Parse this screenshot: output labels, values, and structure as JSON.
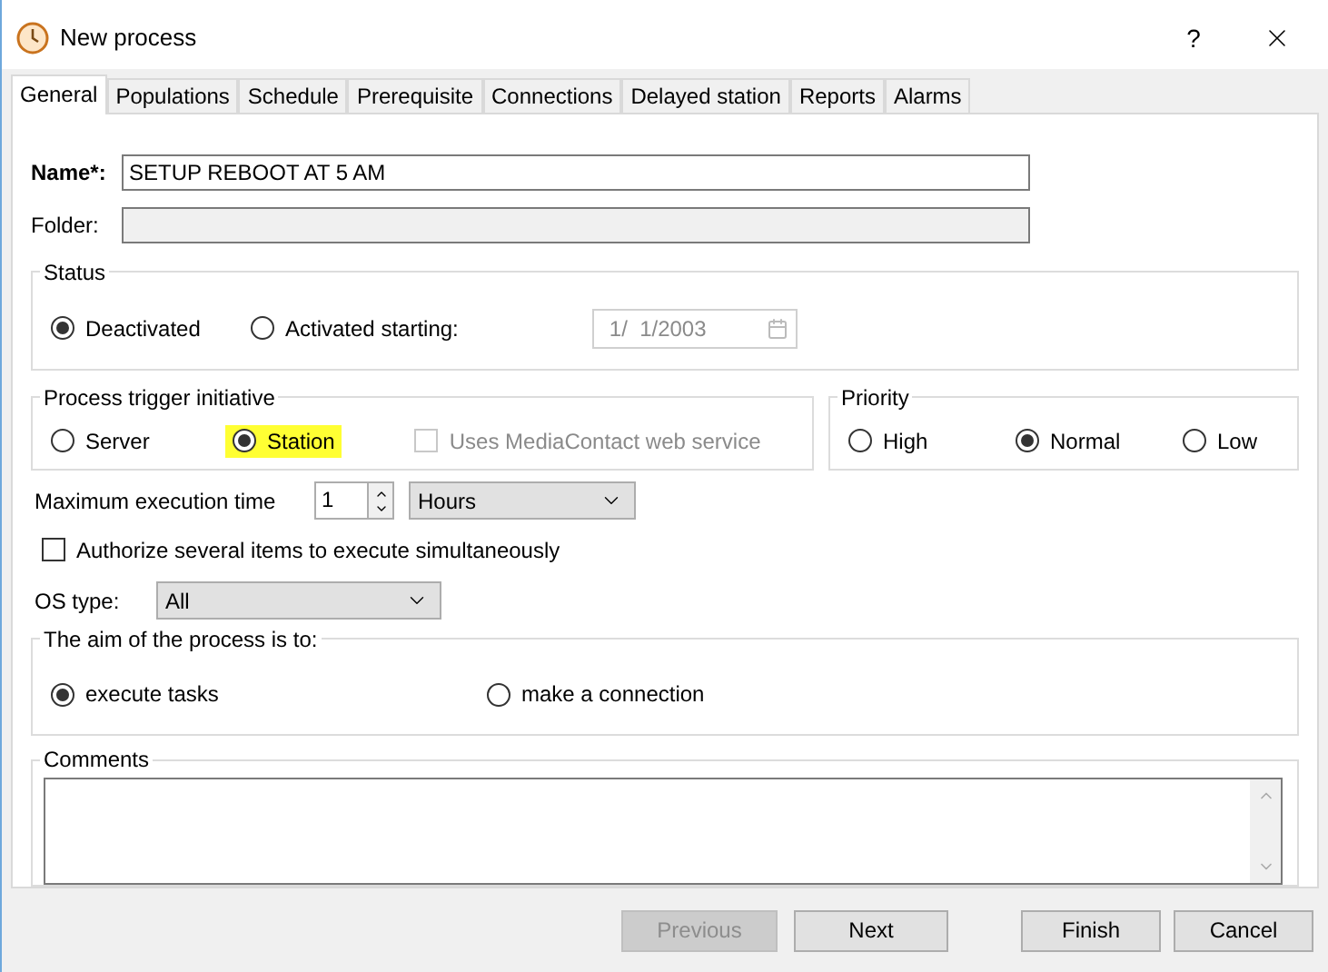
{
  "window": {
    "title": "New process",
    "help": "?"
  },
  "tabs": [
    {
      "label": "General",
      "selected": true
    },
    {
      "label": "Populations",
      "selected": false
    },
    {
      "label": "Schedule",
      "selected": false
    },
    {
      "label": "Prerequisite",
      "selected": false
    },
    {
      "label": "Connections",
      "selected": false
    },
    {
      "label": "Delayed station",
      "selected": false
    },
    {
      "label": "Reports",
      "selected": false
    },
    {
      "label": "Alarms",
      "selected": false
    }
  ],
  "name": {
    "label": "Name*:",
    "value": "SETUP REBOOT AT 5 AM"
  },
  "folder": {
    "label": "Folder:",
    "disabled": true
  },
  "status": {
    "title": "Status",
    "options": [
      {
        "label": "Deactivated",
        "selected": true
      },
      {
        "label": "Activated starting:",
        "selected": false
      }
    ],
    "date": {
      "value": "1/  1/2003",
      "disabled": true
    }
  },
  "trigger": {
    "title": "Process trigger initiative",
    "options": [
      {
        "label": "Server",
        "selected": false,
        "highlighted": false
      },
      {
        "label": "Station",
        "selected": true,
        "highlighted": true
      }
    ],
    "web_service": {
      "label": "Uses MediaContact web service",
      "checked": false,
      "disabled": true
    }
  },
  "priority": {
    "title": "Priority",
    "options": [
      {
        "label": "High",
        "selected": false
      },
      {
        "label": "Normal",
        "selected": true
      },
      {
        "label": "Low",
        "selected": false
      }
    ]
  },
  "max_time": {
    "label": "Maximum execution time",
    "value": "1",
    "unit": "Hours"
  },
  "authorize": {
    "label": "Authorize several items to execute simultaneously",
    "checked": false
  },
  "os_type": {
    "label": "OS type:",
    "value": "All"
  },
  "aim": {
    "title": "The aim of the process is to:",
    "options": [
      {
        "label": "execute tasks",
        "selected": true
      },
      {
        "label": "make a connection",
        "selected": false
      }
    ]
  },
  "comments": {
    "title": "Comments"
  },
  "buttons": [
    {
      "label": "Previous",
      "disabled": true
    },
    {
      "label": "Next",
      "disabled": false
    },
    {
      "label": "Finish",
      "disabled": false
    },
    {
      "label": "Cancel",
      "disabled": false
    }
  ]
}
